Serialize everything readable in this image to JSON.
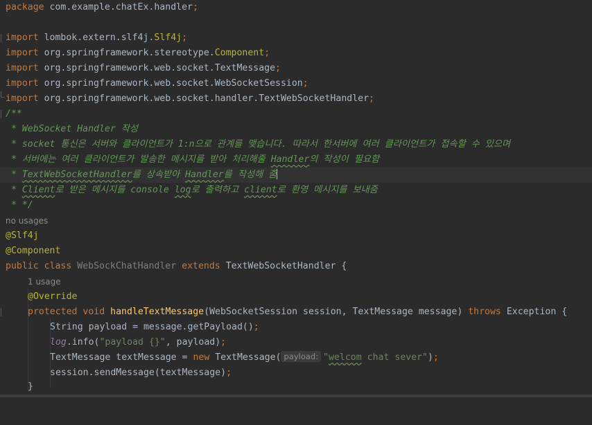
{
  "editor": {
    "package_kw": "package",
    "package_name": " com.example.chatEx.handler",
    "semicolon": ";",
    "import_kw": "import",
    "imports": [
      {
        "path": " lombok.extern.slf4j.",
        "cls": "Slf4j"
      },
      {
        "path": " org.springframework.stereotype.",
        "cls": "Component"
      },
      {
        "path": " org.springframework.web.socket.TextMessage",
        "cls": ""
      },
      {
        "path": " org.springframework.web.socket.WebSocketSession",
        "cls": ""
      },
      {
        "path": " org.springframework.web.socket.handler.TextWebSocketHandler",
        "cls": ""
      }
    ],
    "doc": {
      "open": "/**",
      "line1": " * WebSocket Handler 작성",
      "line2": " * socket 통신은 서버와 클라이언트가 1:n으로 관계를 맺습니다. 따라서 한서버에 여러 클라이언트가 접속할 수 있으며",
      "line3_a": " * 서버에는 여러 클라이언트가 발송한 메시지를 받아 처리해줄 ",
      "line3_b": "Handler",
      "line3_c": "의 작성이 필요함",
      "line4_a": " * ",
      "line4_b": "TextWebSocketHandler",
      "line4_c": "를 상속받아 ",
      "line4_d": "Handler",
      "line4_e": "를 작성해 줌",
      "line5_a": " * ",
      "line5_b": "Client",
      "line5_c": "로 받은 메시지를 console ",
      "line5_d": "log",
      "line5_e": "로 출력하고 ",
      "line5_f": "client",
      "line5_g": "로 환영 메시지를 보내줌",
      "close": " * */"
    },
    "hint_no_usages": "no usages",
    "ann_slf4j": "@Slf4j",
    "ann_component": "@Component",
    "class_decl": {
      "public_kw": "public",
      "class_kw": "class",
      "class_name": "WebSockChatHandler",
      "extends_kw": "extends",
      "super_name": "TextWebSocketHandler",
      "brace": " {"
    },
    "hint_usage": "1 usage",
    "ann_override": "@Override",
    "method": {
      "protected_kw": "protected",
      "void_kw": "void",
      "name": "handleTextMessage",
      "params": "(WebSocketSession session, TextMessage message) ",
      "throws_kw": "throws",
      "rest": " Exception {"
    },
    "body1": "String payload = message.getPayload()",
    "body2_field": "log",
    "body2_a": ".info(",
    "body2_str": "\"payload {}\"",
    "body2_b": ", payload)",
    "body3_a": "TextMessage textMessage = ",
    "body3_new": "new",
    "body3_b": " TextMessage(",
    "body3_hint": "payload:",
    "body3_str_q": "\"",
    "body3_str_w": "welcom",
    "body3_str_rest": " chat sever\"",
    "body3_c": ")",
    "body4": "session.sendMessage(textMessage)",
    "close_brace": "}"
  }
}
